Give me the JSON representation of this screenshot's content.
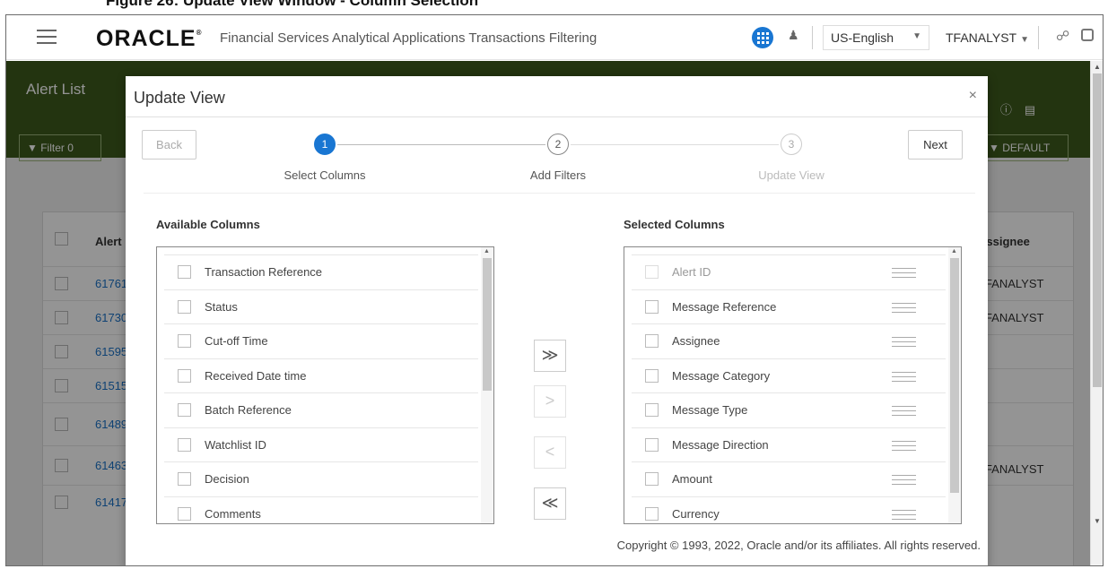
{
  "caption": "Figure 26: Update View Window - Column Selection",
  "header": {
    "logo": "ORACLE",
    "logo_mark": "®",
    "app_title": "Financial Services Analytical Applications Transactions Filtering",
    "language": "US-English",
    "user": "TFANALYST"
  },
  "background": {
    "page_title": "Alert List",
    "filter_label": "Filter",
    "filter_count": "0",
    "view_label": "DEFAULT",
    "col_alert": "Alert I",
    "col_assignee": "Assignee",
    "rows": [
      {
        "id": "61761",
        "assignee": "TFANALYST"
      },
      {
        "id": "61730",
        "assignee": "TFANALYST"
      },
      {
        "id": "61595",
        "assignee": ""
      },
      {
        "id": "61515",
        "assignee": ""
      },
      {
        "id": "61489",
        "assignee": ""
      },
      {
        "id": "61463",
        "assignee": "TFANALYST"
      },
      {
        "id": "61417",
        "assignee": ""
      }
    ]
  },
  "modal": {
    "title": "Update View",
    "close_glyph": "×",
    "back_label": "Back",
    "next_label": "Next",
    "steps": [
      {
        "number": "1",
        "label": "Select Columns",
        "state": "active"
      },
      {
        "number": "2",
        "label": "Add Filters",
        "state": "pending"
      },
      {
        "number": "3",
        "label": "Update View",
        "state": "disabled"
      }
    ],
    "available_title": "Available Columns",
    "selected_title": "Selected Columns",
    "available_columns": [
      "Transaction Reference",
      "Status",
      "Cut-off Time",
      "Received Date time",
      "Batch Reference",
      "Watchlist ID",
      "Decision",
      "Comments"
    ],
    "selected_columns": [
      "Alert ID",
      "Message Reference",
      "Assignee",
      "Message Category",
      "Message Type",
      "Message Direction",
      "Amount",
      "Currency"
    ],
    "move_all_right": "≫",
    "move_right": ">",
    "move_left": "<",
    "move_all_left": "≪"
  },
  "footer": {
    "copyright": "Copyright © 1993, 2022, Oracle and/or its affiliates. All rights reserved."
  },
  "colors": {
    "accent": "#1976d2",
    "header_green": "#3d5a1d",
    "link_blue": "#1a73c8"
  }
}
